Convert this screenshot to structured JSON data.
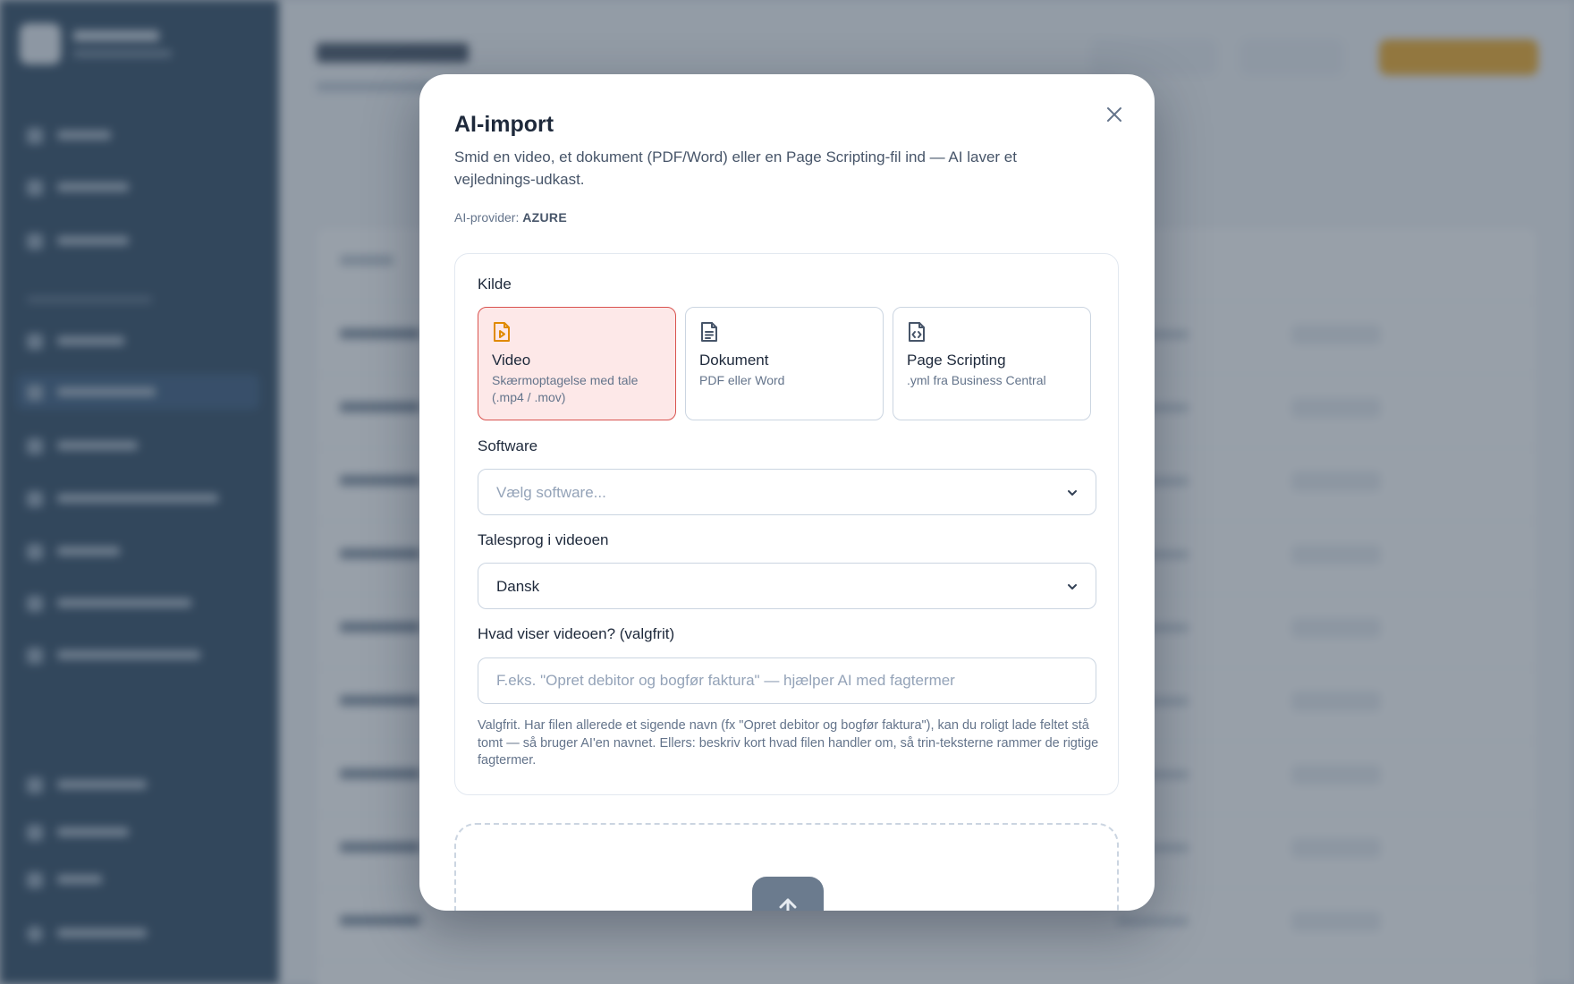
{
  "modal": {
    "title": "AI-import",
    "description": "Smid en video, et dokument (PDF/Word) eller en Page Scripting-fil ind — AI laver et vejlednings-udkast.",
    "provider_label": "AI-provider:",
    "provider_value": "AZURE",
    "close_icon": "close-icon"
  },
  "source": {
    "label": "Kilde",
    "options": [
      {
        "title": "Video",
        "subtitle": "Skærmoptagelse med tale (.mp4 / .mov)",
        "icon": "file-video-icon",
        "selected": true
      },
      {
        "title": "Dokument",
        "subtitle": "PDF eller Word",
        "icon": "file-text-icon",
        "selected": false
      },
      {
        "title": "Page Scripting",
        "subtitle": ".yml fra Business Central",
        "icon": "file-code-icon",
        "selected": false
      }
    ]
  },
  "software": {
    "label": "Software",
    "placeholder": "Vælg software..."
  },
  "language": {
    "label": "Talesprog i videoen",
    "value": "Dansk"
  },
  "topic": {
    "label": "Hvad viser videoen? (valgfrit)",
    "placeholder": "F.eks. \"Opret debitor og bogfør faktura\" — hjælper AI med fagtermer",
    "value": "",
    "hint": "Valgfrit. Har filen allerede et sigende navn (fx \"Opret debitor og bogfør faktura\"), kan du roligt lade feltet stå tomt — så bruger AI'en navnet. Ellers: beskriv kort hvad filen handler om, så trin-teksterne rammer de rigtige fagtermer."
  },
  "dropzone": {
    "icon": "upload-icon"
  },
  "colors": {
    "accent": "#f2a516",
    "selected_bg": "#fde8e8",
    "selected_border": "#d9534f",
    "sidebar": "#1e3a55"
  }
}
